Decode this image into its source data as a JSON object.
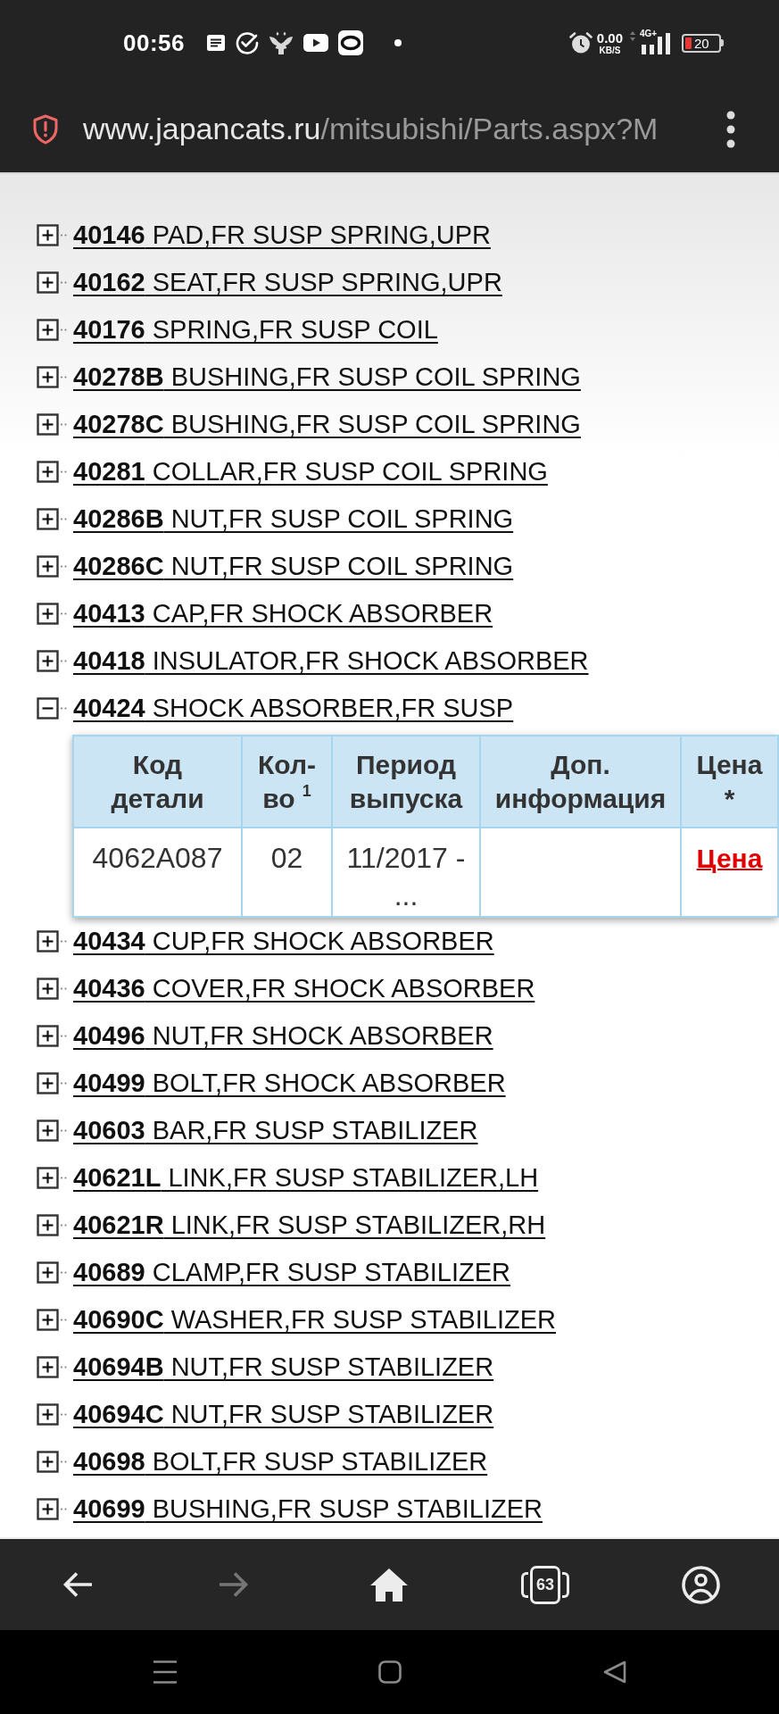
{
  "status_bar": {
    "time": "00:56",
    "network_speed": "0.00",
    "network_speed_unit": "KB/S",
    "network_type": "4G+",
    "battery": "20"
  },
  "address_bar": {
    "url_host": "www.japancats.ru",
    "url_path": "/mitsubishi/Parts.aspx?M"
  },
  "parts": [
    {
      "code": "40146",
      "name": "PAD,FR SUSP SPRING,UPR",
      "expanded": false
    },
    {
      "code": "40162",
      "name": "SEAT,FR SUSP SPRING,UPR",
      "expanded": false
    },
    {
      "code": "40176",
      "name": "SPRING,FR SUSP COIL",
      "expanded": false
    },
    {
      "code": "40278B",
      "name": "BUSHING,FR SUSP COIL SPRING",
      "expanded": false
    },
    {
      "code": "40278C",
      "name": "BUSHING,FR SUSP COIL SPRING",
      "expanded": false
    },
    {
      "code": "40281",
      "name": "COLLAR,FR SUSP COIL SPRING",
      "expanded": false
    },
    {
      "code": "40286B",
      "name": "NUT,FR SUSP COIL SPRING",
      "expanded": false
    },
    {
      "code": "40286C",
      "name": "NUT,FR SUSP COIL SPRING",
      "expanded": false
    },
    {
      "code": "40413",
      "name": "CAP,FR SHOCK ABSORBER",
      "expanded": false
    },
    {
      "code": "40418",
      "name": "INSULATOR,FR SHOCK ABSORBER",
      "expanded": false
    },
    {
      "code": "40424",
      "name": "SHOCK ABSORBER,FR SUSP",
      "expanded": true,
      "details": {
        "columns": [
          "Код детали",
          "Кол-во $^{1}$",
          "Период выпуска",
          "Доп. информация",
          "Цена *"
        ],
        "rows": [
          {
            "part_number": "4062A087",
            "quantity": "02",
            "period": "11/2017 - ...",
            "price_link": "Цена"
          }
        ]
      }
    },
    {
      "code": "40434",
      "name": "CUP,FR SHOCK ABSORBER",
      "expanded": false
    },
    {
      "code": "40436",
      "name": "COVER,FR SHOCK ABSORBER",
      "expanded": false
    },
    {
      "code": "40496",
      "name": "NUT,FR SHOCK ABSORBER",
      "expanded": false
    },
    {
      "code": "40499",
      "name": "BOLT,FR SHOCK ABSORBER",
      "expanded": false
    },
    {
      "code": "40603",
      "name": "BAR,FR SUSP STABILIZER",
      "expanded": false
    },
    {
      "code": "40621L",
      "name": "LINK,FR SUSP STABILIZER,LH",
      "expanded": false
    },
    {
      "code": "40621R",
      "name": "LINK,FR SUSP STABILIZER,RH",
      "expanded": false
    },
    {
      "code": "40689",
      "name": "CLAMP,FR SUSP STABILIZER",
      "expanded": false
    },
    {
      "code": "40690C",
      "name": "WASHER,FR SUSP STABILIZER",
      "expanded": false
    },
    {
      "code": "40694B",
      "name": "NUT,FR SUSP STABILIZER",
      "expanded": false
    },
    {
      "code": "40694C",
      "name": "NUT,FR SUSP STABILIZER",
      "expanded": false
    },
    {
      "code": "40698",
      "name": "BOLT,FR SUSP STABILIZER",
      "expanded": false
    },
    {
      "code": "40699",
      "name": "BUSHING,FR SUSP STABILIZER",
      "expanded": false
    }
  ],
  "toolbar": {
    "buttons": [
      {
        "kind": "back",
        "disabled": false
      },
      {
        "kind": "forward",
        "disabled": true
      },
      {
        "kind": "home"
      },
      {
        "kind": "tabs",
        "count": "63"
      },
      {
        "kind": "account"
      }
    ]
  }
}
